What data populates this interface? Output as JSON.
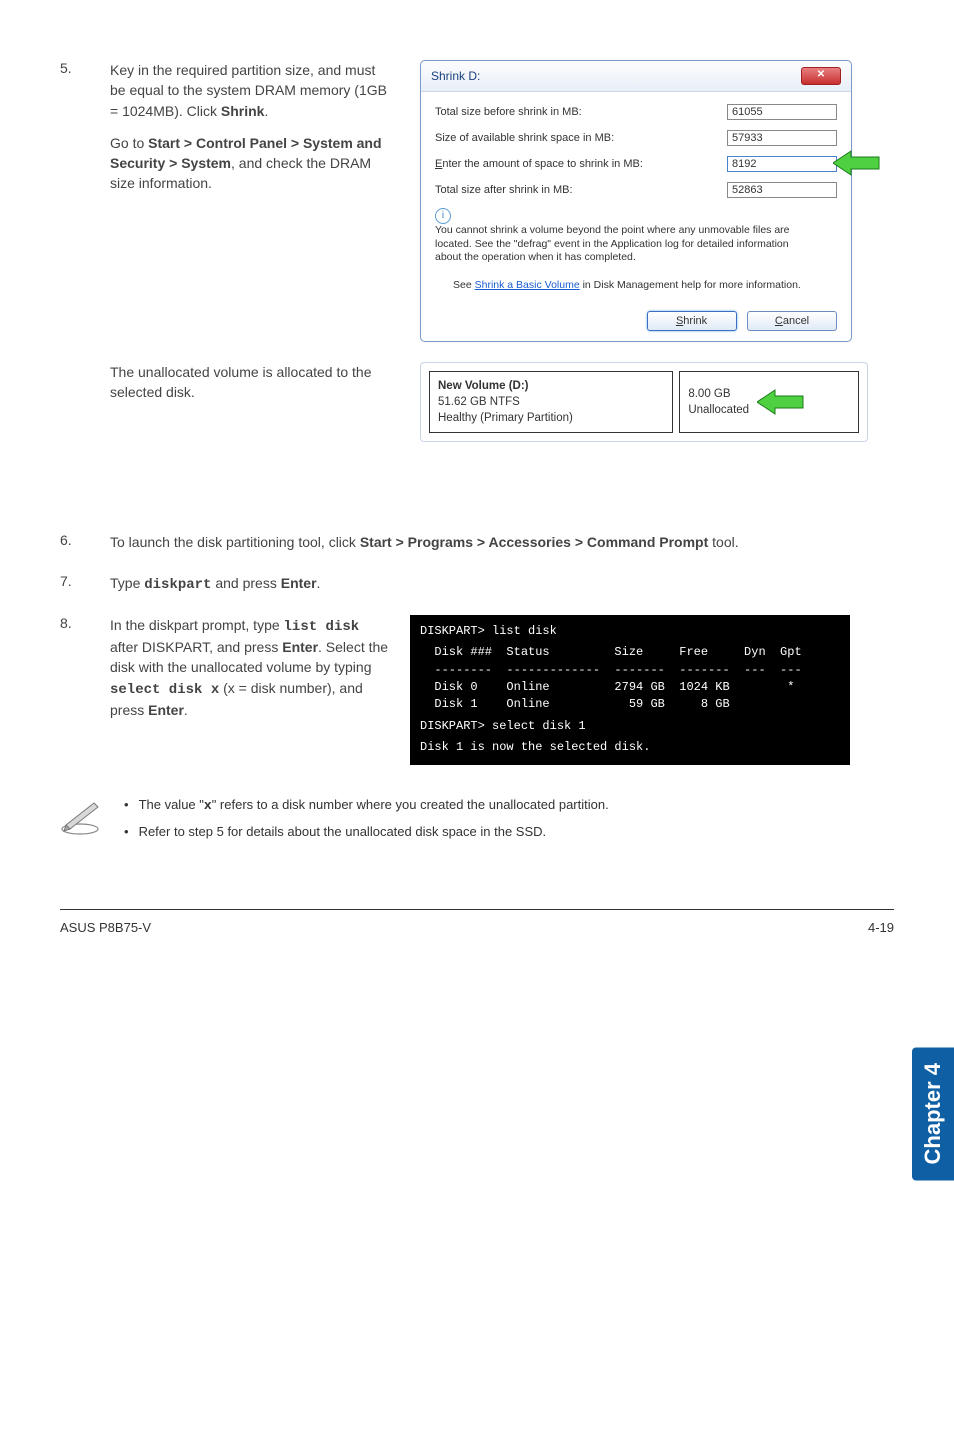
{
  "step5": {
    "num": "5.",
    "text1a": "Key in the required partition size, and must be equal to the system DRAM memory (1GB = 1024MB). Click ",
    "text1b": "Shrink",
    "text1c": ".",
    "text2a": "Go to ",
    "text2b": "Start > Control Panel > System and Security > System",
    "text2c": ", and check the DRAM size information.",
    "text3": "The unallocated volume is allocated to the selected disk."
  },
  "shrink": {
    "title": "Shrink D:",
    "lbl1": "Total size before shrink in MB:",
    "val1": "61055",
    "lbl2": "Size of available shrink space in MB:",
    "val2": "57933",
    "lbl3": "Enter the amount of space to shrink in MB:",
    "val3": "8192",
    "lbl4": "Total size after shrink in MB:",
    "val4": "52863",
    "info": "You cannot shrink a volume beyond the point where any unmovable files are located. See the \"defrag\" event in the Application log for detailed information about the operation when it has completed.",
    "see1": "See ",
    "see_link": "Shrink a Basic Volume",
    "see2": " in Disk Management help for more information.",
    "btn_shrink": "Shrink",
    "btn_cancel": "Cancel",
    "close": "✕"
  },
  "vol": {
    "left_title": "New Volume  (D:)",
    "left_l2": "51.62 GB NTFS",
    "left_l3": "Healthy (Primary Partition)",
    "right_l1": "8.00 GB",
    "right_l2": "Unallocated"
  },
  "step6": {
    "num": "6.",
    "t1": "To launch the disk partitioning tool, click ",
    "t2": "Start > Programs > Accessories > Command Prompt",
    "t3": " tool."
  },
  "step7": {
    "num": "7.",
    "t1": "Type ",
    "code": "diskpart",
    "t2": " and press ",
    "t3": "Enter",
    "t4": "."
  },
  "step8": {
    "num": "8.",
    "t1": "In the diskpart prompt, type ",
    "code1": "list disk",
    "t2": " after DISKPART, and press ",
    "t3": "Enter",
    "t4": ". Select the disk with the unallocated volume by typing ",
    "code2": "select disk x",
    "t5": " (x = disk number), and press ",
    "t6": "Enter",
    "t7": "."
  },
  "dp": {
    "l1": "DISKPART> list disk",
    "h1": "  Disk ###  Status         Size     Free     Dyn  Gpt",
    "h2": "  --------  -------------  -------  -------  ---  ---",
    "r1": "  Disk 0    Online         2794 GB  1024 KB        *",
    "r2": "  Disk 1    Online           59 GB     8 GB",
    "l2": "DISKPART> select disk 1",
    "l3": "Disk 1 is now the selected disk."
  },
  "notes": {
    "b1a": "The value \"",
    "b1code": "x",
    "b1b": "\" refers to a disk number where you created the unallocated partition.",
    "b2": "Refer to step 5 for details about the unallocated disk space in the SSD."
  },
  "chapter": "Chapter 4",
  "footer_left": "ASUS P8B75-V",
  "footer_right": "4-19"
}
